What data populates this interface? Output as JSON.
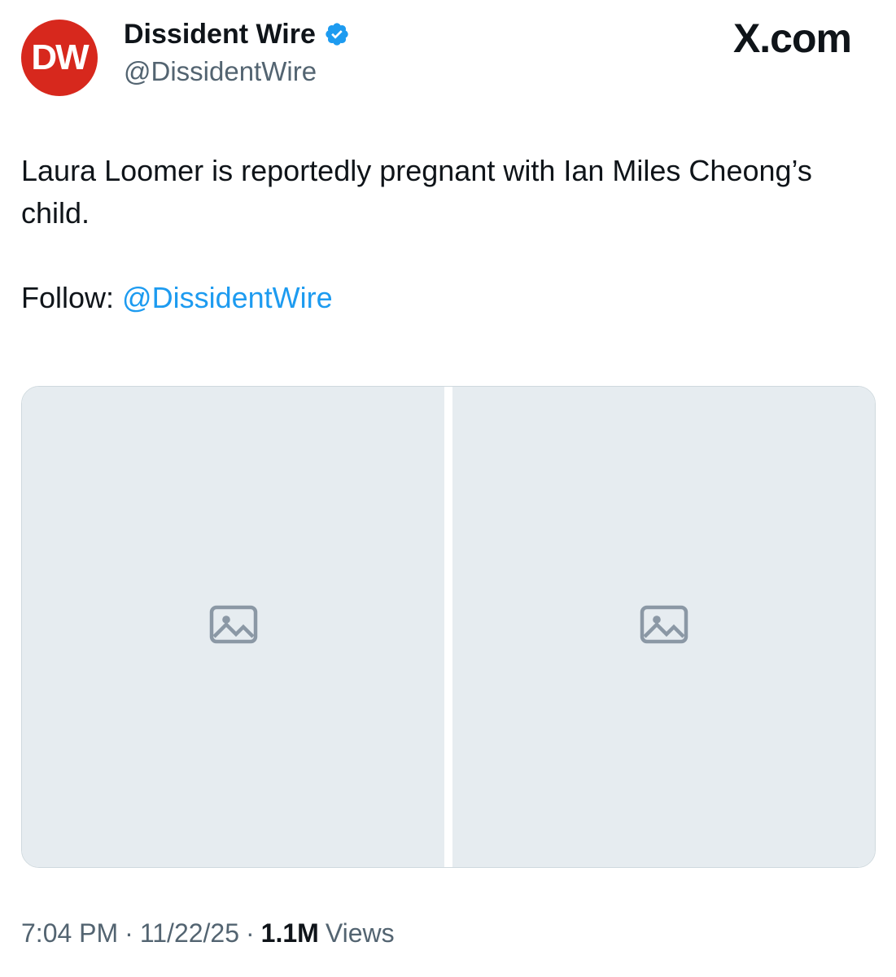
{
  "author": {
    "avatar_text": "DW",
    "display_name": "Dissident Wire",
    "handle": "@DissidentWire",
    "verified": true
  },
  "site_mark": "X.com",
  "post": {
    "text": "Laura Loomer is reportedly pregnant with Ian Miles Cheong’s child.",
    "follow_label": "Follow:",
    "follow_mention": "@DissidentWire"
  },
  "media": {
    "count": 2,
    "placeholder_icon": "image-placeholder-icon"
  },
  "meta": {
    "time": "7:04 PM",
    "date": "11/22/25",
    "views_count": "1.1M",
    "views_label": "Views",
    "separator": "·"
  },
  "colors": {
    "avatar_bg": "#d7281d",
    "verified": "#1d9bf0",
    "link": "#1d9bf0",
    "secondary_text": "#536471",
    "primary_text": "#0f1419"
  }
}
